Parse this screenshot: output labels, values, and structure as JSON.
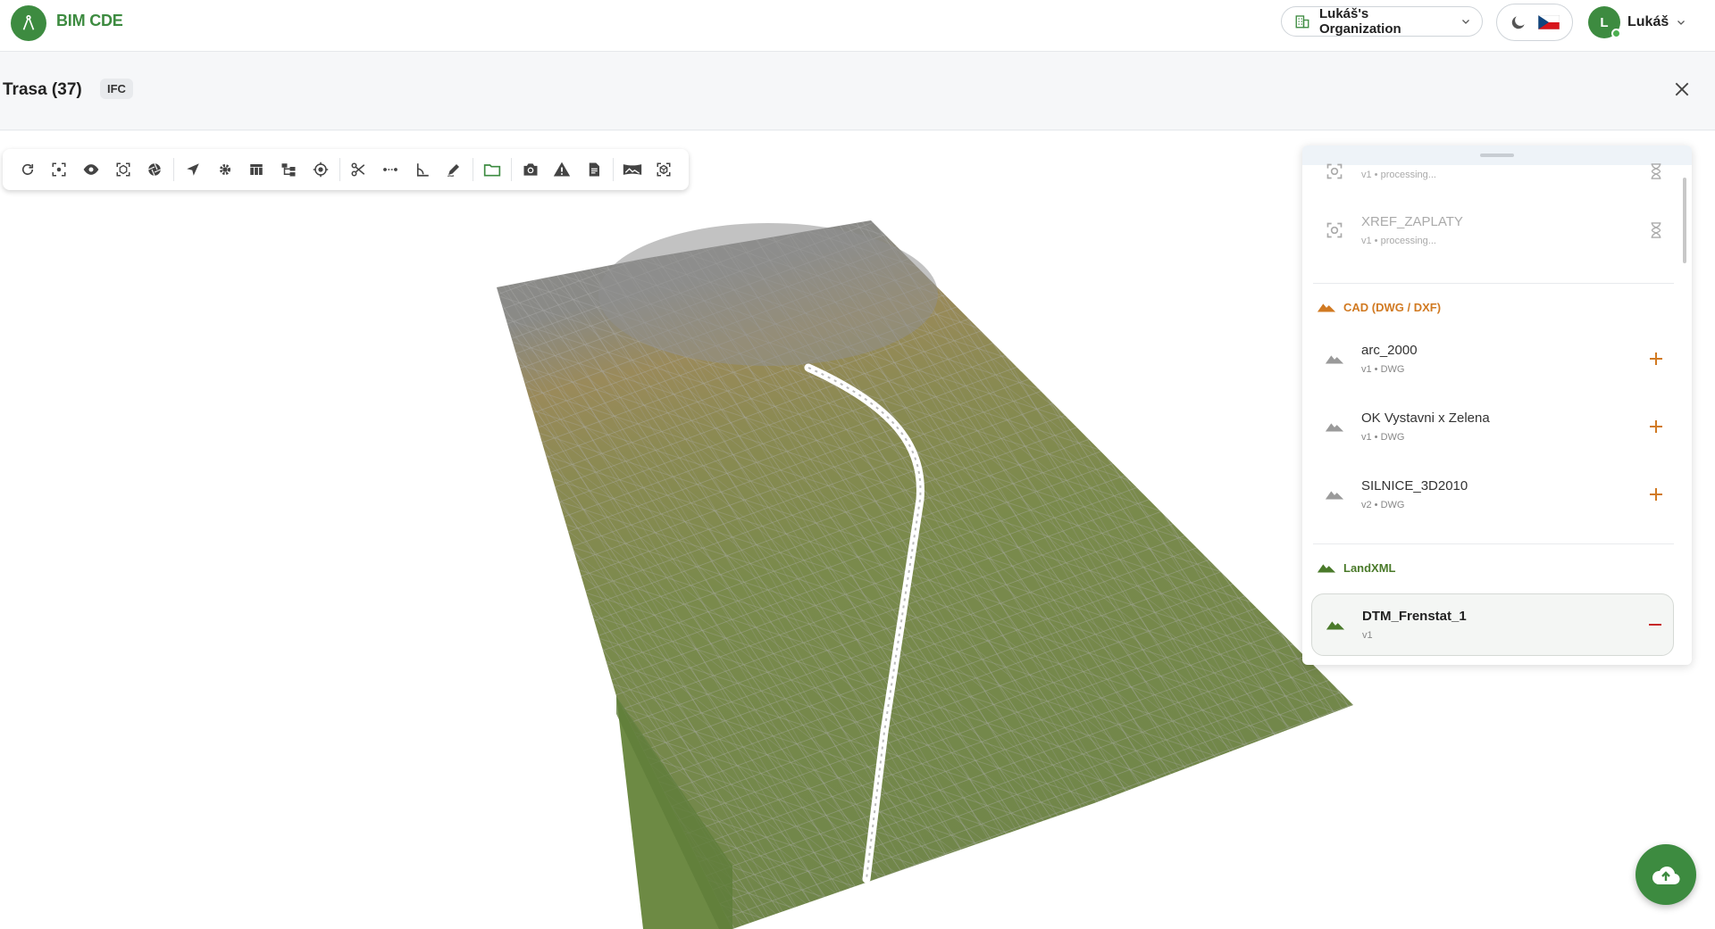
{
  "app": {
    "brand": "BIM CDE",
    "organization": "Lukáš's Organization",
    "user_initial": "L",
    "user_name": "Lukáš",
    "accent_color": "#3d8b40"
  },
  "header": {
    "title": "Trasa (37)",
    "badge": "IFC"
  },
  "toolbar": {
    "icons": [
      "refresh-icon",
      "focus-icon",
      "eye-icon",
      "isolate-icon",
      "aperture-icon",
      "navigate-icon",
      "settings-icon",
      "table-icon",
      "tree-icon",
      "target-icon",
      "scissors-icon",
      "measure-distance-icon",
      "measure-angle-icon",
      "markup-icon",
      "folder-icon",
      "camera-icon",
      "warning-icon",
      "document-icon",
      "panorama-icon",
      "model-icon"
    ]
  },
  "panel": {
    "processing_items": [
      {
        "name": "",
        "meta": "v1 • processing..."
      },
      {
        "name": "XREF_ZAPLATY",
        "meta": "v1 • processing..."
      }
    ],
    "sections": [
      {
        "title": "CAD (DWG / DXF)",
        "color": "#d17a22",
        "items": [
          {
            "name": "arc_2000",
            "meta": "v1 • DWG"
          },
          {
            "name": "OK Vystavni x Zelena",
            "meta": "v1 • DWG"
          },
          {
            "name": "SILNICE_3D2010",
            "meta": "v2 • DWG"
          }
        ]
      },
      {
        "title": "LandXML",
        "color": "#4a7a2a",
        "items": [
          {
            "name": "DTM_Frenstat_1",
            "meta": "v1",
            "active": true
          }
        ]
      }
    ]
  }
}
